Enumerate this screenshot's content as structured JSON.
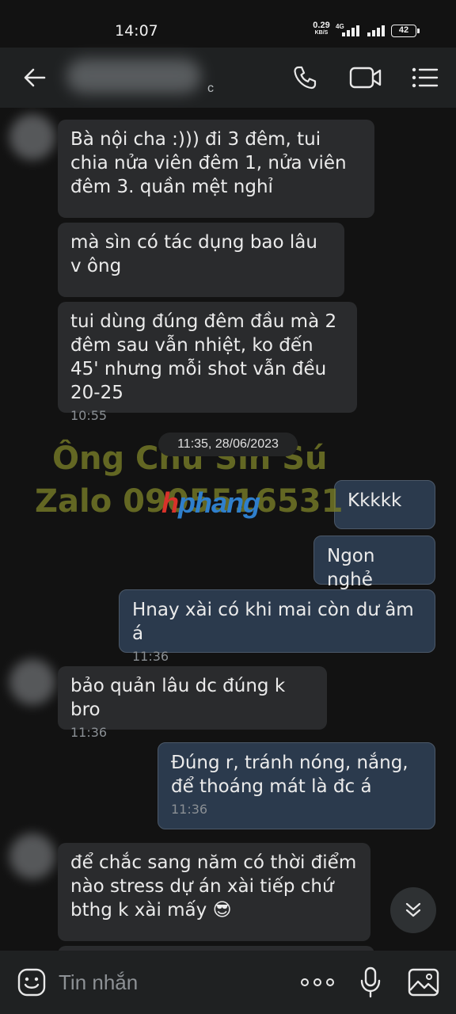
{
  "status_bar": {
    "time": "14:07",
    "net_speed": "0.29",
    "net_unit": "KB/S",
    "network_type": "4G",
    "battery": "42"
  },
  "header": {
    "contact_subtitle": "c",
    "icons": [
      "back-arrow-icon",
      "phone-icon",
      "video-call-icon",
      "menu-icon"
    ]
  },
  "messages": [
    {
      "side": "in",
      "text": "Bà nội cha :))) đi 3 đêm, tui chia nửa viên đêm 1, nửa viên đêm 3. quần mệt nghỉ",
      "time": ""
    },
    {
      "side": "in",
      "text": "mà sìn có tác dụng bao lâu v ông",
      "time": ""
    },
    {
      "side": "in",
      "text": "tui dùng đúng đêm đầu mà 2 đêm sau vẫn nhiệt, ko đến 45' nhưng mỗi shot vẫn đều 20-25",
      "time": "10:55"
    },
    {
      "side": "out",
      "text": "Kkkkk",
      "time": ""
    },
    {
      "side": "out",
      "text": "Ngon nghẻ",
      "time": ""
    },
    {
      "side": "out",
      "text": "Hnay xài có khi mai còn dư âm á",
      "time": "11:36"
    },
    {
      "side": "in",
      "text": "bảo quản lâu dc đúng k bro",
      "time": "11:36"
    },
    {
      "side": "out",
      "text": "Đúng r, tránh nóng, nắng, để thoáng mát là đc á",
      "time": "11:36"
    },
    {
      "side": "in",
      "text": "để chắc sang năm có thời điểm nào stress dự án xài tiếp chứ bthg k xài mấy 😎",
      "time": ""
    }
  ],
  "date_separator": "11:35, 28/06/2023",
  "watermark": {
    "line1": "Ông Chủ Sìn Sú",
    "line2": "Zalo 0905516531",
    "logo_a": "h",
    "logo_b": "phang"
  },
  "input": {
    "placeholder": "Tin nhắn",
    "icons": [
      "emoji-icon",
      "more-icon",
      "microphone-icon",
      "image-icon"
    ]
  },
  "colors": {
    "background": "#121212",
    "bar": "#1f2122",
    "incoming_bubble": "#2a2b2d",
    "outgoing_bubble": "#2b3a4d",
    "watermark": "#787d28"
  }
}
